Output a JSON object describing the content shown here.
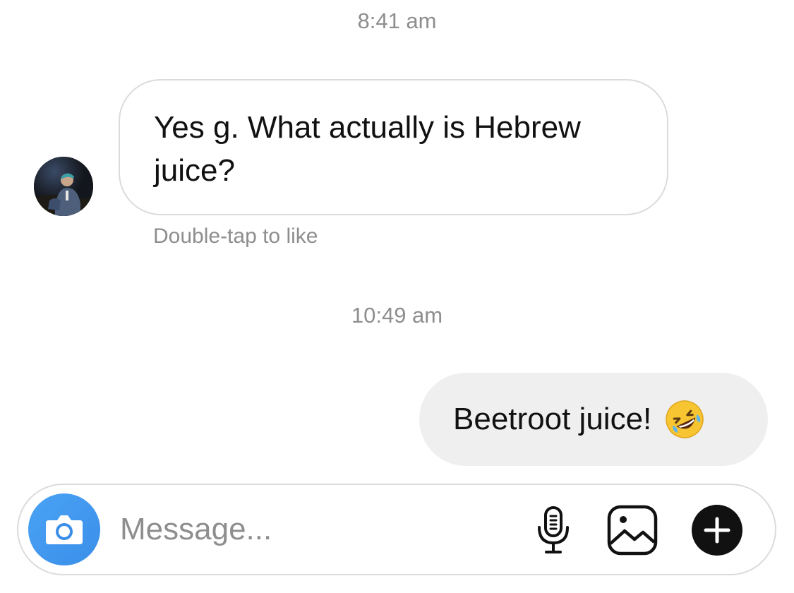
{
  "thread": {
    "timestamp_1": "8:41 am",
    "incoming_message": "Yes g. What actually is Hebrew juice?",
    "like_hint": "Double-tap to like",
    "timestamp_2": "10:49 am",
    "outgoing_message": "Beetroot juice!",
    "outgoing_emoji": "rolling-on-floor-laughing-emoji"
  },
  "composer": {
    "placeholder": "Message...",
    "value": ""
  },
  "icons": {
    "camera": "camera-icon",
    "mic": "microphone-icon",
    "gallery": "gallery-icon",
    "plus": "plus-circle-icon"
  },
  "colors": {
    "camera_button": "#3897f0",
    "outgoing_bubble": "#efefef",
    "incoming_border": "#dbdbdb",
    "meta_text": "#8e8e8e"
  }
}
